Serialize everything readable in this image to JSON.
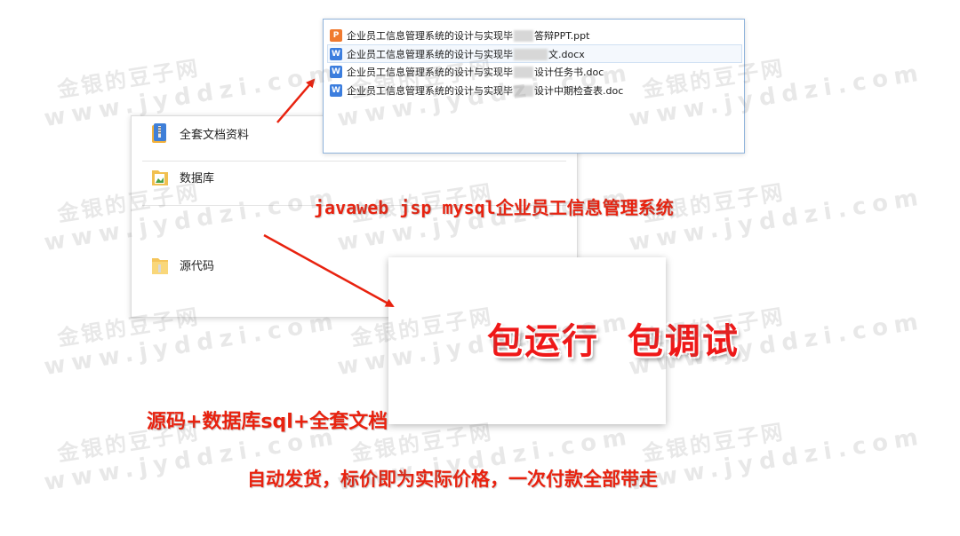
{
  "explorer": {
    "folders": [
      {
        "label": "全套文档资料",
        "icon": "blue-zip-folder-icon"
      },
      {
        "label": "数据库",
        "icon": "green-database-folder-icon"
      },
      {
        "label": "源代码",
        "icon": "yellow-folder-icon"
      }
    ]
  },
  "docs": [
    {
      "type": "ppt",
      "icon_letter": "P",
      "prefix": "企业员工信息管理系统的设计与实现毕",
      "suffix": "答辩PPT.ppt"
    },
    {
      "type": "doc",
      "icon_letter": "W",
      "prefix": "企业员工信息管理系统的设计与实现毕",
      "suffix": "文.docx"
    },
    {
      "type": "doc",
      "icon_letter": "W",
      "prefix": "企业员工信息管理系统的设计与实现毕",
      "suffix": "设计任务书.doc"
    },
    {
      "type": "doc",
      "icon_letter": "W",
      "prefix": "企业员工信息管理系统的设计与实现毕",
      "suffix": "设计中期检查表.doc"
    }
  ],
  "title_text": "javaweb jsp mysql企业员工信息管理系统",
  "slogan_text": "包运行  包调试",
  "sub_text": "源码+数据库sql+全套文档",
  "notice_text": "自动发货，标价即为实际价格，一次付款全部带走",
  "watermark": {
    "cn": "金银的豆子网",
    "en": "www.jyddzi.com"
  },
  "colors": {
    "accent_red": "#e8220f",
    "slogan_red": "#ef1818",
    "ppt_orange": "#f07a2f",
    "word_blue": "#3c7ede"
  }
}
